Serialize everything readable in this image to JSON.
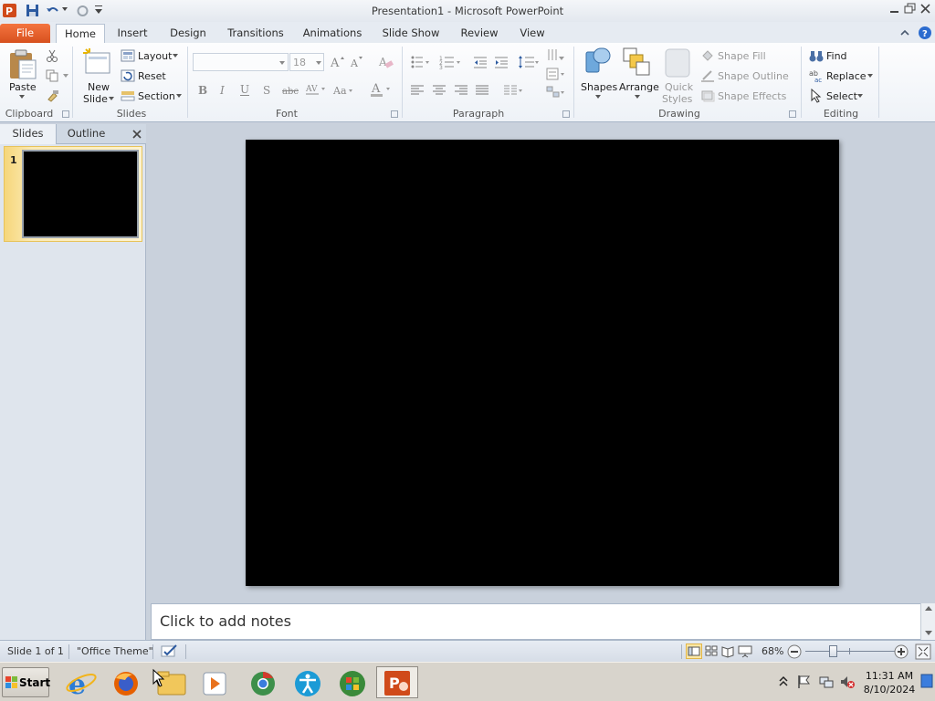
{
  "window": {
    "title": "Presentation1 - Microsoft PowerPoint"
  },
  "tabs": [
    {
      "label": "File"
    },
    {
      "label": "Home"
    },
    {
      "label": "Insert"
    },
    {
      "label": "Design"
    },
    {
      "label": "Transitions"
    },
    {
      "label": "Animations"
    },
    {
      "label": "Slide Show"
    },
    {
      "label": "Review"
    },
    {
      "label": "View"
    }
  ],
  "ribbon": {
    "clipboard": {
      "group_label": "Clipboard",
      "paste_label": "Paste"
    },
    "slides": {
      "group_label": "Slides",
      "new_slide_label_1": "New",
      "new_slide_label_2": "Slide",
      "layout_label": "Layout",
      "reset_label": "Reset",
      "section_label": "Section"
    },
    "font": {
      "group_label": "Font",
      "font_name_value": "",
      "font_size_value": "18"
    },
    "paragraph": {
      "group_label": "Paragraph"
    },
    "drawing": {
      "group_label": "Drawing",
      "shapes_label": "Shapes",
      "arrange_label": "Arrange",
      "quick_styles_label_1": "Quick",
      "quick_styles_label_2": "Styles",
      "shape_fill_label": "Shape Fill",
      "shape_outline_label": "Shape Outline",
      "shape_effects_label": "Shape Effects"
    },
    "editing": {
      "group_label": "Editing",
      "find_label": "Find",
      "replace_label": "Replace",
      "select_label": "Select"
    }
  },
  "left_panel": {
    "tab_slides": "Slides",
    "tab_outline": "Outline",
    "slides": [
      {
        "number": "1",
        "background": "#000000"
      }
    ]
  },
  "slide": {
    "background": "#000000"
  },
  "notes": {
    "placeholder": "Click to add notes"
  },
  "status_bar": {
    "slide_info": "Slide 1 of 1",
    "theme": "\"Office Theme\"",
    "zoom": "68%"
  },
  "taskbar": {
    "start_label": "Start",
    "apps": [
      "internet-explorer-icon",
      "firefox-icon",
      "file-explorer-icon",
      "media-player-icon",
      "chrome-icon",
      "accessibility-icon",
      "windows-icon",
      "powerpoint-icon"
    ],
    "clock_time": "11:31 AM",
    "clock_date": "8/10/2024"
  },
  "colors": {
    "file_tab": "#d64f1d",
    "ribbon_bg": "#fdfdfe",
    "work_area": "#c9d1dc",
    "slide_bg": "#000000"
  }
}
